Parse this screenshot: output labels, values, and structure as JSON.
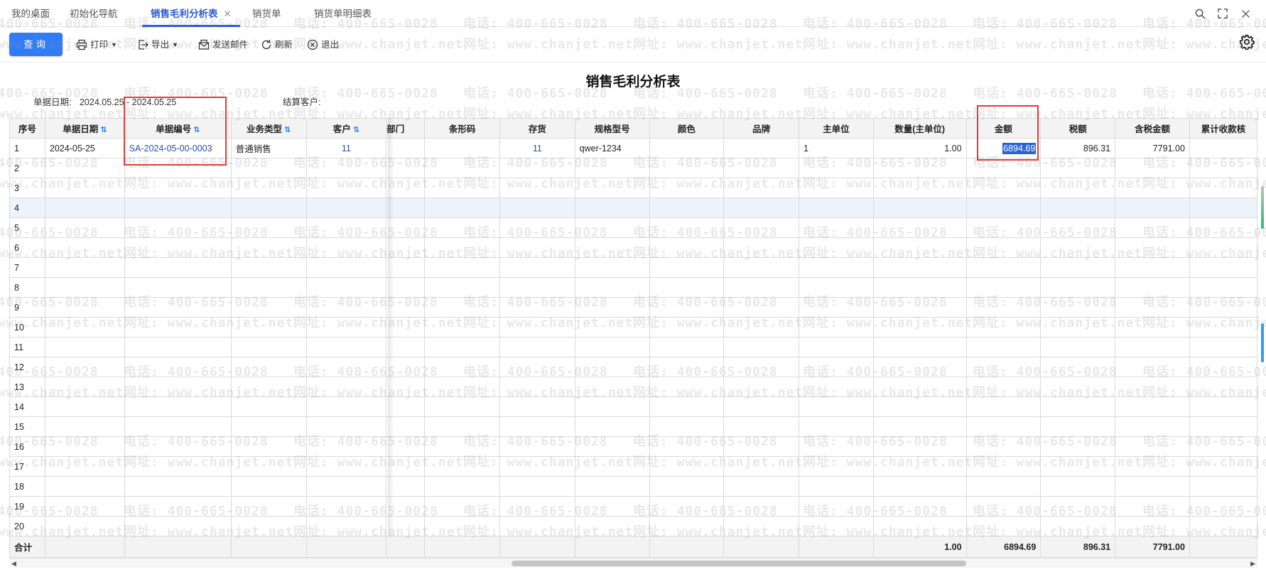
{
  "tabs": [
    {
      "label": "我的桌面"
    },
    {
      "label": "初始化导航"
    },
    {
      "label": "销售毛利分析表"
    },
    {
      "label": "销货单"
    },
    {
      "label": "销货单明细表"
    }
  ],
  "tab_close": "✕",
  "toolbar": {
    "query": "查询",
    "print": "打印",
    "export": "导出",
    "email": "发送邮件",
    "refresh": "刷新",
    "exit": "退出"
  },
  "report": {
    "title": "销售毛利分析表",
    "date_label": "单据日期:",
    "date_value": "2024.05.25 - 2024.05.25",
    "customer_label": "结算客户:"
  },
  "columns": [
    "序号",
    "单据日期",
    "单据编号",
    "业务类型",
    "客户",
    "部门",
    "条形码",
    "存货",
    "规格型号",
    "颜色",
    "品牌",
    "主单位",
    "数量(主单位)",
    "金额",
    "税额",
    "含税金额",
    "累计收款核"
  ],
  "rows": [
    {
      "seq": "1",
      "date": "2024-05-25",
      "code": "SA-2024-05-00-0003",
      "type": "普通销售",
      "customer": "11",
      "dept": "",
      "barcode": "",
      "item": "11",
      "spec": "qwer-1234",
      "color": "",
      "brand": "",
      "unit": "1",
      "qty": "1.00",
      "amount": "6894.69",
      "tax": "896.31",
      "taxamt": "7791.00",
      "recv": ""
    },
    {
      "seq": "2"
    },
    {
      "seq": "3"
    },
    {
      "seq": "4"
    },
    {
      "seq": "5"
    },
    {
      "seq": "6"
    },
    {
      "seq": "7"
    },
    {
      "seq": "8"
    },
    {
      "seq": "9"
    },
    {
      "seq": "10"
    },
    {
      "seq": "11"
    },
    {
      "seq": "12"
    },
    {
      "seq": "13"
    },
    {
      "seq": "14"
    },
    {
      "seq": "15"
    },
    {
      "seq": "16"
    },
    {
      "seq": "17"
    },
    {
      "seq": "18"
    },
    {
      "seq": "19"
    },
    {
      "seq": "20"
    }
  ],
  "total": {
    "label": "合计",
    "qty": "1.00",
    "amount": "6894.69",
    "tax": "896.31",
    "taxamt": "7791.00"
  },
  "watermark": {
    "phone": "电话: 400-665-0028",
    "site": "网址: www.chanjet.net"
  },
  "colors": {
    "accent": "#2f7cf6",
    "highlight_box": "#e53935",
    "link": "#2a4ea8"
  }
}
